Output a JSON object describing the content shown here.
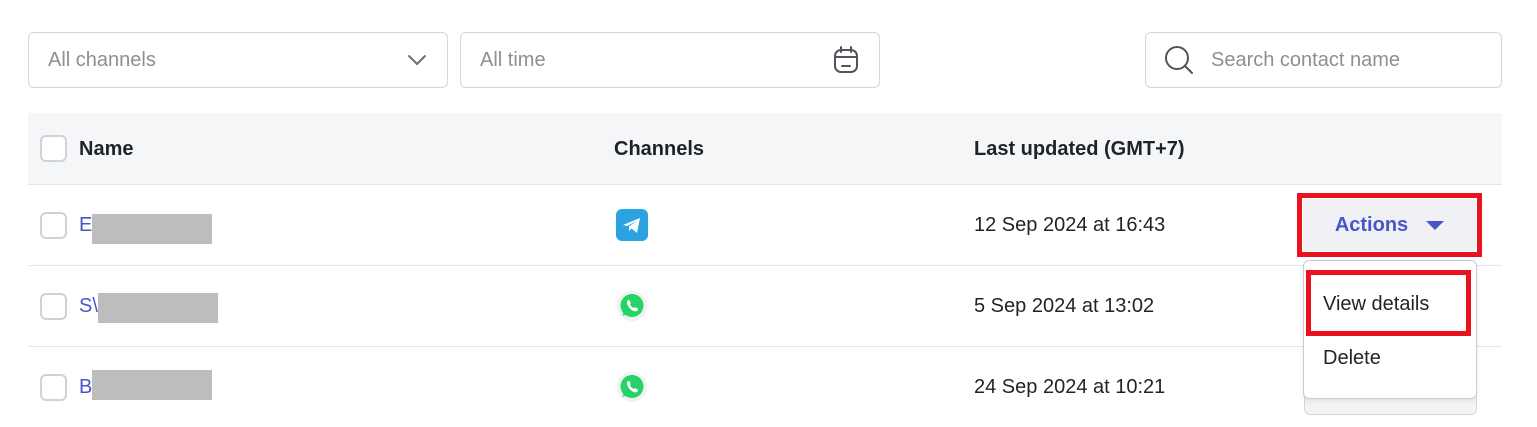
{
  "filters": {
    "channel": "All channels",
    "time": "All time",
    "search_placeholder": "Search contact name"
  },
  "table": {
    "columns": [
      "Name",
      "Channels",
      "Last updated (GMT+7)"
    ],
    "rows": [
      {
        "name_visible": "E",
        "channel": "telegram-icon",
        "updated": "12 Sep 2024 at 16:43"
      },
      {
        "name_visible": "S\\",
        "channel": "whatsapp-icon",
        "updated": "5 Sep 2024 at 13:02"
      },
      {
        "name_visible": "B",
        "channel": "whatsapp-icon",
        "updated": "24 Sep 2024 at 10:21"
      }
    ]
  },
  "actions": {
    "label": "Actions",
    "menu": [
      "View details",
      "Delete"
    ]
  },
  "colors": {
    "accent": "#4a55c9",
    "highlight": "#e8131e",
    "telegram": "#2aa3e0",
    "whatsapp": "#25d366"
  }
}
